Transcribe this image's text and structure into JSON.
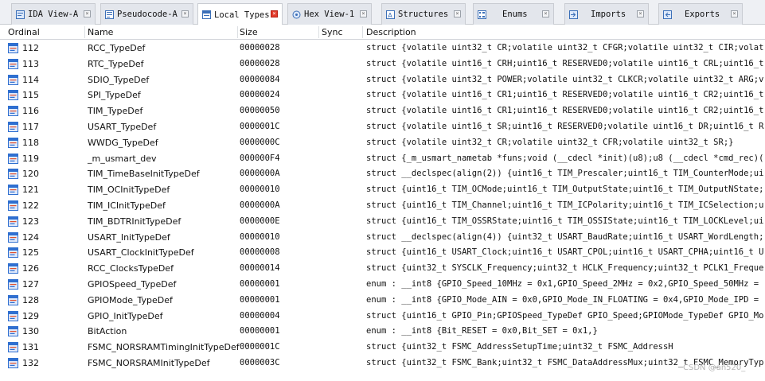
{
  "tabs": [
    {
      "label": "IDA View-A",
      "icon": "ida-view-icon",
      "active": false
    },
    {
      "label": "Pseudocode-A",
      "icon": "pseudocode-icon",
      "active": false
    },
    {
      "label": "Local Types",
      "icon": "local-types-icon",
      "active": true
    },
    {
      "label": "Hex View-1",
      "icon": "hex-view-icon",
      "active": false
    },
    {
      "label": "Structures",
      "icon": "structures-icon",
      "active": false
    },
    {
      "label": "Enums",
      "icon": "enums-icon",
      "active": false
    },
    {
      "label": "Imports",
      "icon": "imports-icon",
      "active": false
    },
    {
      "label": "Exports",
      "icon": "exports-icon",
      "active": false
    }
  ],
  "columns": {
    "ordinal": "Ordinal",
    "name": "Name",
    "size": "Size",
    "sync": "Sync",
    "description": "Description"
  },
  "rows": [
    {
      "ordinal": "112",
      "name": "RCC_TypeDef",
      "size": "00000028",
      "sync": "",
      "description": "struct {volatile uint32_t CR;volatile uint32_t CFGR;volatile uint32_t CIR;volat"
    },
    {
      "ordinal": "113",
      "name": "RTC_TypeDef",
      "size": "00000028",
      "sync": "",
      "description": "struct {volatile uint16_t CRH;uint16_t RESERVED0;volatile uint16_t CRL;uint16_t"
    },
    {
      "ordinal": "114",
      "name": "SDIO_TypeDef",
      "size": "00000084",
      "sync": "",
      "description": "struct {volatile uint32_t POWER;volatile uint32_t CLKCR;volatile uint32_t ARG;v"
    },
    {
      "ordinal": "115",
      "name": "SPI_TypeDef",
      "size": "00000024",
      "sync": "",
      "description": "struct {volatile uint16_t CR1;uint16_t RESERVED0;volatile uint16_t CR2;uint16_t"
    },
    {
      "ordinal": "116",
      "name": "TIM_TypeDef",
      "size": "00000050",
      "sync": "",
      "description": "struct {volatile uint16_t CR1;uint16_t RESERVED0;volatile uint16_t CR2;uint16_t"
    },
    {
      "ordinal": "117",
      "name": "USART_TypeDef",
      "size": "0000001C",
      "sync": "",
      "description": "struct {volatile uint16_t SR;uint16_t RESERVED0;volatile uint16_t DR;uint16_t R"
    },
    {
      "ordinal": "118",
      "name": "WWDG_TypeDef",
      "size": "0000000C",
      "sync": "",
      "description": "struct {volatile uint32_t CR;volatile uint32_t CFR;volatile uint32_t SR;}"
    },
    {
      "ordinal": "119",
      "name": "_m_usmart_dev",
      "size": "000000F4",
      "sync": "",
      "description": "struct {_m_usmart_nametab *funs;void (__cdecl *init)(u8);u8 (__cdecl *cmd_rec)("
    },
    {
      "ordinal": "120",
      "name": "TIM_TimeBaseInitTypeDef",
      "size": "0000000A",
      "sync": "",
      "description": "struct __declspec(align(2)) {uint16_t TIM_Prescaler;uint16_t TIM_CounterMode;ui"
    },
    {
      "ordinal": "121",
      "name": "TIM_OCInitTypeDef",
      "size": "00000010",
      "sync": "",
      "description": "struct {uint16_t TIM_OCMode;uint16_t TIM_OutputState;uint16_t TIM_OutputNState;"
    },
    {
      "ordinal": "122",
      "name": "TIM_ICInitTypeDef",
      "size": "0000000A",
      "sync": "",
      "description": "struct {uint16_t TIM_Channel;uint16_t TIM_ICPolarity;uint16_t TIM_ICSelection;u"
    },
    {
      "ordinal": "123",
      "name": "TIM_BDTRInitTypeDef",
      "size": "0000000E",
      "sync": "",
      "description": "struct {uint16_t TIM_OSSRState;uint16_t TIM_OSSIState;uint16_t TIM_LOCKLevel;ui"
    },
    {
      "ordinal": "124",
      "name": "USART_InitTypeDef",
      "size": "00000010",
      "sync": "",
      "description": "struct __declspec(align(4)) {uint32_t USART_BaudRate;uint16_t USART_WordLength;"
    },
    {
      "ordinal": "125",
      "name": "USART_ClockInitTypeDef",
      "size": "00000008",
      "sync": "",
      "description": "struct {uint16_t USART_Clock;uint16_t USART_CPOL;uint16_t USART_CPHA;uint16_t U"
    },
    {
      "ordinal": "126",
      "name": "RCC_ClocksTypeDef",
      "size": "00000014",
      "sync": "",
      "description": "struct {uint32_t SYSCLK_Frequency;uint32_t HCLK_Frequency;uint32_t PCLK1_Freque"
    },
    {
      "ordinal": "127",
      "name": "GPIOSpeed_TypeDef",
      "size": "00000001",
      "sync": "",
      "description": "enum : __int8 {GPIO_Speed_10MHz = 0x1,GPIO_Speed_2MHz = 0x2,GPIO_Speed_50MHz ="
    },
    {
      "ordinal": "128",
      "name": "GPIOMode_TypeDef",
      "size": "00000001",
      "sync": "",
      "description": "enum : __int8 {GPIO_Mode_AIN = 0x0,GPIO_Mode_IN_FLOATING = 0x4,GPIO_Mode_IPD ="
    },
    {
      "ordinal": "129",
      "name": "GPIO_InitTypeDef",
      "size": "00000004",
      "sync": "",
      "description": "struct {uint16_t GPIO_Pin;GPIOSpeed_TypeDef GPIO_Speed;GPIOMode_TypeDef GPIO_Mo"
    },
    {
      "ordinal": "130",
      "name": "BitAction",
      "size": "00000001",
      "sync": "",
      "description": "enum : __int8 {Bit_RESET = 0x0,Bit_SET = 0x1,}"
    },
    {
      "ordinal": "131",
      "name": "FSMC_NORSRAMTimingInitTypeDef",
      "size": "0000001C",
      "sync": "",
      "description": "struct {uint32_t FSMC_AddressSetupTime;uint32_t FSMC_AddressH"
    },
    {
      "ordinal": "132",
      "name": "FSMC_NORSRAMInitTypeDef",
      "size": "0000003C",
      "sync": "",
      "description": "struct {uint32_t FSMC_Bank;uint32_t FSMC_DataAddressMux;uint32_t FSMC_MemoryTyp"
    }
  ],
  "watermark": "CSDN @an520_",
  "colors": {
    "active_close": "#e23a2a",
    "row_icon": "#2f6fd0",
    "tab_bg": "#e3e6ec"
  }
}
